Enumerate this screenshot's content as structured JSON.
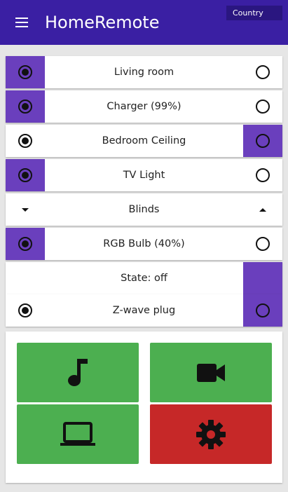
{
  "app": {
    "title": "HomeRemote",
    "country_label": "Country",
    "brand_color": "#3a1fa3"
  },
  "colors": {
    "active_segment": "#6a3fbd",
    "tile_green": "#4caf50",
    "tile_red": "#c62828"
  },
  "rows": [
    {
      "label": "Living room",
      "left_radio": "checked",
      "right_radio": "unchecked",
      "active_side": "left"
    },
    {
      "label": "Charger (99%)",
      "left_radio": "checked",
      "right_radio": "unchecked",
      "active_side": "left"
    },
    {
      "label": "Bedroom Ceiling",
      "left_radio": "checked",
      "right_radio": "unchecked",
      "active_side": "right"
    },
    {
      "label": "TV Light",
      "left_radio": "checked",
      "right_radio": "unchecked",
      "active_side": "left"
    },
    {
      "label": "Blinds",
      "left_icon": "arrow-down-icon",
      "right_icon": "arrow-up-icon"
    },
    {
      "label": "RGB Bulb (40%)",
      "left_radio": "checked",
      "right_radio": "unchecked",
      "active_side": "left"
    },
    {
      "label": "State: off",
      "active_side": "right"
    },
    {
      "label": "Z-wave plug",
      "left_radio": "checked",
      "right_radio": "unchecked",
      "active_side": "right"
    }
  ],
  "tiles": [
    {
      "icon": "music-note-icon",
      "color": "#4caf50"
    },
    {
      "icon": "video-camera-icon",
      "color": "#4caf50"
    },
    {
      "icon": "laptop-icon",
      "color": "#4caf50"
    },
    {
      "icon": "gear-icon",
      "color": "#c62828"
    }
  ]
}
